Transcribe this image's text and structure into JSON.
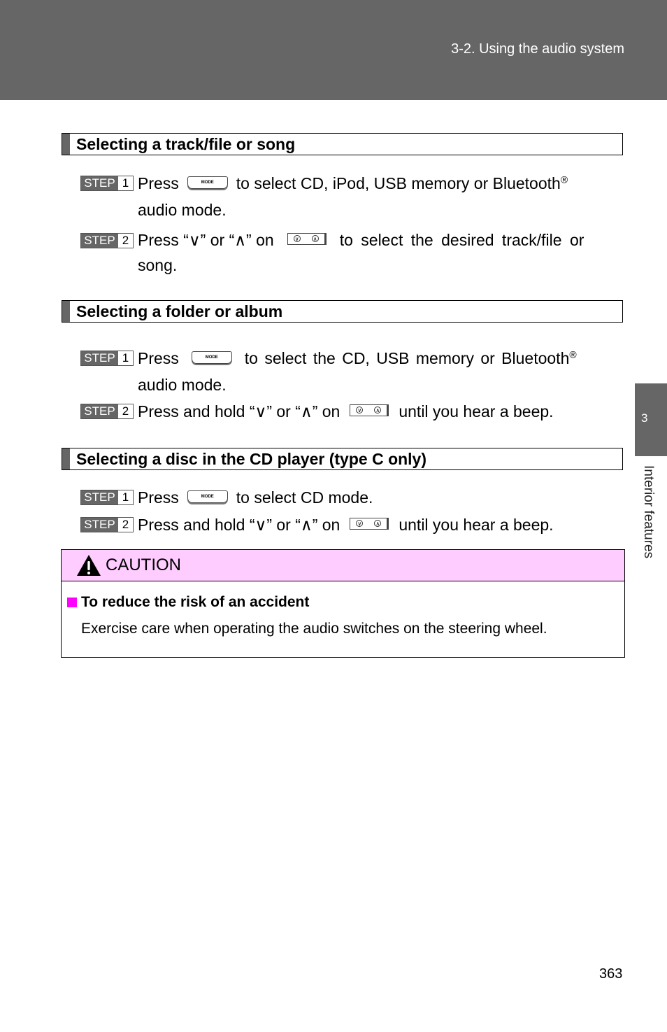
{
  "header": {
    "title": "3-2. Using the audio system"
  },
  "side_tab": {
    "number": "3",
    "label": "Interior features"
  },
  "sections": [
    {
      "title": "Selecting a track/file or song",
      "steps": [
        {
          "step_label": "STEP",
          "step_num": "1",
          "before": "Press",
          "button": "MODE",
          "after": "to select CD, iPod, USB memory or Bluetooth",
          "reg": "®",
          "cont": "audio mode."
        },
        {
          "step_label": "STEP",
          "step_num": "2",
          "before": "Press “∨” or “∧” on",
          "button": "seek",
          "after": "to select the desired track/file or",
          "cont": "song."
        }
      ]
    },
    {
      "title": "Selecting a folder or album",
      "steps": [
        {
          "step_label": "STEP",
          "step_num": "1",
          "before": "Press",
          "button": "MODE",
          "after": "to select the CD, USB memory or Bluetooth",
          "reg": "®",
          "cont": "audio mode."
        },
        {
          "step_label": "STEP",
          "step_num": "2",
          "before": "Press and hold “∨” or “∧” on",
          "button": "seek",
          "after": "until you hear a beep."
        }
      ]
    },
    {
      "title": "Selecting a disc in the CD player (type C only)",
      "steps": [
        {
          "step_label": "STEP",
          "step_num": "1",
          "before": "Press",
          "button": "MODE",
          "after": "to select CD mode."
        },
        {
          "step_label": "STEP",
          "step_num": "2",
          "before": "Press and hold “∨” or “∧” on",
          "button": "seek",
          "after": "until you hear a beep."
        }
      ]
    }
  ],
  "buttons": {
    "mode_label": "MODE",
    "down_glyph": "∨",
    "up_glyph": "∧"
  },
  "caution": {
    "title": "CAUTION",
    "subtitle": "To reduce the risk of an accident",
    "body": "Exercise care when operating the audio switches on the steering wheel.",
    "header_color": "#ffccff",
    "bullet_color": "#ff00ff"
  },
  "page_number": "363"
}
